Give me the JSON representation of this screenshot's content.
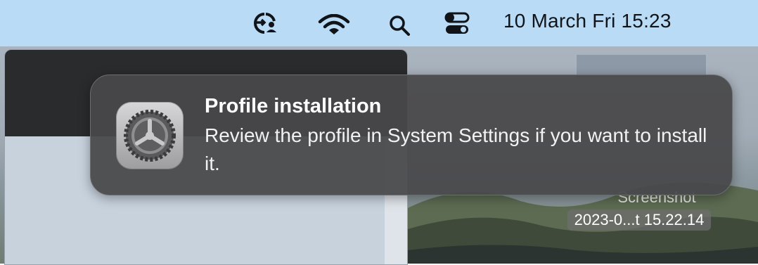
{
  "menubar": {
    "icons": [
      "vpn-status-icon",
      "wifi-icon",
      "spotlight-search-icon",
      "control-center-icon"
    ],
    "date_time": "10 March Fri  15:23",
    "background_color": "#b9dbf6"
  },
  "notification": {
    "app_icon": "system-settings-gear-icon",
    "title": "Profile installation",
    "body": "Review the profile in System Settings if you want to install it."
  },
  "desktop": {
    "file_label_line1": "Screenshot",
    "file_label_line2": "2023-0...t 15.22.14"
  }
}
